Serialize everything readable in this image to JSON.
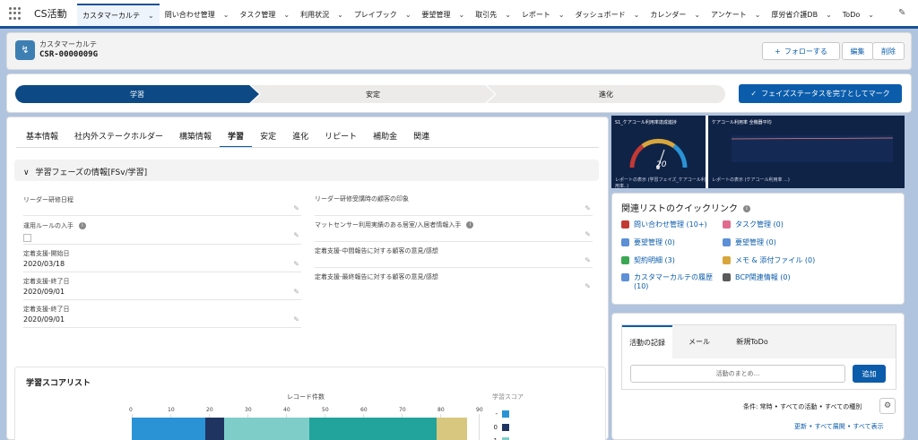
{
  "app": {
    "name": "CS活動"
  },
  "nav": {
    "tabs": [
      {
        "label": "カスタマーカルテ"
      },
      {
        "label": "問い合わせ管理"
      },
      {
        "label": "タスク管理"
      },
      {
        "label": "利用状況"
      },
      {
        "label": "プレイブック"
      },
      {
        "label": "要望管理"
      },
      {
        "label": "取引先"
      },
      {
        "label": "レポート"
      },
      {
        "label": "ダッシュボード"
      },
      {
        "label": "カレンダー"
      },
      {
        "label": "アンケート"
      },
      {
        "label": "厚労省介護DB"
      },
      {
        "label": "ToDo"
      }
    ]
  },
  "record": {
    "object_label": "カスタマーカルテ",
    "name": "CSR-0000009G",
    "follow_label": "フォローする",
    "edit_label": "編集",
    "delete_label": "削除"
  },
  "path": {
    "stages": [
      "学習",
      "安定",
      "進化"
    ],
    "complete_label": "フェイズステータスを完了としてマーク"
  },
  "detail": {
    "tabs": [
      "基本情報",
      "社内外ステークホルダー",
      "構築情報",
      "学習",
      "安定",
      "進化",
      "リピート",
      "補助金",
      "関連"
    ],
    "section_title": "学習フェーズの情報[FSv/学習]",
    "left_fields": [
      {
        "label": "リーダー研修日程",
        "value": ""
      },
      {
        "label": "運用ルールの入手",
        "value": ""
      },
      {
        "label": "定着支援-開始日",
        "value": "2020/03/18"
      },
      {
        "label": "定着支援-終了日",
        "value": "2020/09/01"
      },
      {
        "label": "定着支援-終了日",
        "value": "2020/09/01"
      }
    ],
    "right_fields": [
      {
        "label": "リーダー研修受講時の顧客の印象",
        "value": ""
      },
      {
        "label": "マットセンサー利用実績のある居室/入居者情報入手",
        "value": ""
      },
      {
        "label": "定着支援-中間報告に対する顧客の意見/感想",
        "value": ""
      },
      {
        "label": "定着支援-最終報告に対する顧客の意見/感想",
        "value": ""
      }
    ]
  },
  "score_list": {
    "title": "学習スコアリスト",
    "axis_label": "レコード件数",
    "legend_title": "学習スコア",
    "legend": [
      {
        "label": "-",
        "color": "#2a93d5"
      },
      {
        "label": "0",
        "color": "#1f3460"
      },
      {
        "label": "1",
        "color": "#7ecdc9"
      }
    ]
  },
  "chart_data": {
    "type": "bar",
    "orientation": "horizontal",
    "stacked": true,
    "xlabel": "レコード件数",
    "xlim": [
      0,
      90
    ],
    "ticks": [
      "0",
      "10",
      "20",
      "30",
      "40",
      "50",
      "60",
      "70",
      "80",
      "90"
    ],
    "legend_title": "学習スコア",
    "series": [
      {
        "name": "-",
        "values": [
          19
        ],
        "color": "#2a93d5"
      },
      {
        "name": "0",
        "values": [
          5
        ],
        "color": "#1f3460"
      },
      {
        "name": "1",
        "values": [
          22
        ],
        "color": "#7ecdc9"
      },
      {
        "values": [
          33
        ],
        "color": "#22a39b"
      },
      {
        "values": [
          8
        ],
        "color": "#d8c77f"
      }
    ]
  },
  "dashboard": {
    "left_title": "S1_ケアコール利用率達成進捗",
    "gauge_value": "20",
    "left_footer": "レポートの表示 (学習フェイズ_ケアコール利用率..)",
    "right_title": "ケアコール利用率 全機器平均",
    "right_footer": "レポートの表示 (ケアコール利用率 ...)"
  },
  "quicklinks": {
    "title": "関連リストのクイックリンク",
    "items": [
      {
        "label": "問い合わせ管理 (10+)",
        "color": "#c23934"
      },
      {
        "label": "タスク管理 (0)",
        "color": "#e06b8e"
      },
      {
        "label": "要望管理 (0)",
        "color": "#5b8fd6"
      },
      {
        "label": "要望管理 (0)",
        "color": "#5b8fd6"
      },
      {
        "label": "契約明細 (3)",
        "color": "#3ba755"
      },
      {
        "label": "メモ & 添付ファイル (0)",
        "color": "#d8a63b"
      },
      {
        "label": "カスタマーカルテの履歴 (10)",
        "color": "#5b8fd6"
      },
      {
        "label": "BCP関連情報 (0)",
        "color": "#5a5a5a"
      }
    ]
  },
  "activity": {
    "tabs": [
      "活動の記録",
      "メール",
      "新規ToDo"
    ],
    "input_placeholder": "活動のまとめ...",
    "add_label": "追加",
    "filter_text": "条件: 常時 • すべての活動 • すべての種別",
    "links_text": "更新 • すべて展開 • すべて表示"
  }
}
